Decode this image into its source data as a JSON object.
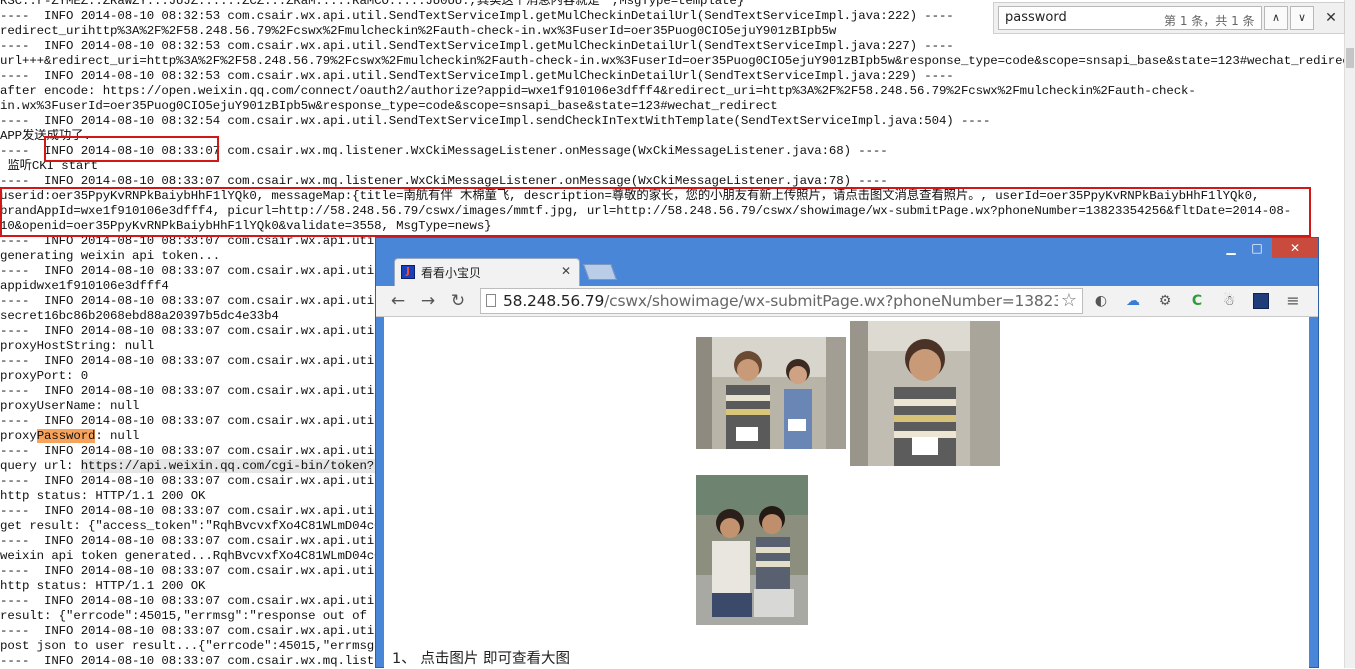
{
  "log": {
    "lines": [
      {
        "text": "RSC..r-ZYMEZ..ZRaWZY...JUJZ......ZCZ...ZRaM.....RaMCO.....JU0UU.,其实这个消息内容就是一,MsgType=template}",
        "parts": null
      },
      {
        "text": "----  INFO 2014-08-10 08:32:53 com.csair.wx.api.util.SendTextServiceImpl.getMulCheckinDetailUrl(SendTextServiceImpl.java:222) ----"
      },
      {
        "text": "redirect_urihttp%3A%2F%2F58.248.56.79%2Fcswx%2Fmulcheckin%2Fauth-check-in.wx%3FuserId=oer35Puog0CIO5ejuY901zBIpb5w"
      },
      {
        "text": "----  INFO 2014-08-10 08:32:53 com.csair.wx.api.util.SendTextServiceImpl.getMulCheckinDetailUrl(SendTextServiceImpl.java:227) ----"
      },
      {
        "text": "url+++&redirect_uri=http%3A%2F%2F58.248.56.79%2Fcswx%2Fmulcheckin%2Fauth-check-in.wx%3FuserId=oer35Puog0CIO5ejuY901zBIpb5w&response_type=code&scope=snsapi_base&state=123#wechat_redirect"
      },
      {
        "text": "----  INFO 2014-08-10 08:32:53 com.csair.wx.api.util.SendTextServiceImpl.getMulCheckinDetailUrl(SendTextServiceImpl.java:229) ----"
      },
      {
        "text": "after encode: https://open.weixin.qq.com/connect/oauth2/authorize?appid=wxe1f910106e3dfff4&redirect_uri=http%3A%2F%2F58.248.56.79%2Fcswx%2Fmulcheckin%2Fauth-check-"
      },
      {
        "text": "in.wx%3FuserId=oer35Puog0CIO5ejuY901zBIpb5w&response_type=code&scope=snsapi_base&state=123#wechat_redirect"
      },
      {
        "text": "----  INFO 2014-08-10 08:32:54 com.csair.wx.api.util.SendTextServiceImpl.sendCheckInTextWithTemplate(SendTextServiceImpl.java:504) ----"
      },
      {
        "text": "APP发送成功了."
      },
      {
        "text": "----  INFO 2014-08-10 08:33:07 com.csair.wx.mq.listener.WxCkiMessageListener.onMessage(WxCkiMessageListener.java:68) ----"
      },
      {
        "text": " 监听CKI start"
      },
      {
        "text": "----  INFO 2014-08-10 08:33:07 com.csair.wx.mq.listener.WxCkiMessageListener.onMessage(WxCkiMessageListener.java:78) ----"
      },
      {
        "text": "userid:oer35PpyKvRNPkBaiybHhF1lYQk0, messageMap:{title=南航有伴 木棉童飞, description=尊敬的家长，您的小朋友有新上传照片，请点击图文消息查看照片。, userId=oer35PpyKvRNPkBaiybHhF1lYQk0,"
      },
      {
        "text": "brandAppId=wxe1f910106e3dfff4, picurl=http://58.248.56.79/cswx/images/mmtf.jpg, url=http://58.248.56.79/cswx/showimage/wx-submitPage.wx?phoneNumber=13823354256&fltDate=2014-08-"
      },
      {
        "text": "10&openid=oer35PpyKvRNPkBaiybHhF1lYQk0&validate=3558, MsgType=news}"
      },
      {
        "text": "----  INFO 2014-08-10 08:33:07 com.csair.wx.api.util."
      },
      {
        "text": "generating weixin api token..."
      },
      {
        "text": "----  INFO 2014-08-10 08:33:07 com.csair.wx.api.util."
      },
      {
        "text": "appidwxe1f910106e3dfff4"
      },
      {
        "text": "----  INFO 2014-08-10 08:33:07 com.csair.wx.api.util."
      },
      {
        "text": "secret16bc86b2068ebd88a20397b5dc4e33b4"
      },
      {
        "text": "----  INFO 2014-08-10 08:33:07 com.csair.wx.api.util."
      },
      {
        "text": "proxyHostString: null"
      },
      {
        "text": "----  INFO 2014-08-10 08:33:07 com.csair.wx.api.util."
      },
      {
        "text": "proxyPort: 0"
      },
      {
        "text": "----  INFO 2014-08-10 08:33:07 com.csair.wx.api.util."
      },
      {
        "text": "proxyUserName: null"
      },
      {
        "text": "----  INFO 2014-08-10 08:33:07 com.csair.wx.api.util."
      },
      {
        "text": "proxyPassword: null"
      },
      {
        "text": "----  INFO 2014-08-10 08:33:07 com.csair.wx.api.util."
      },
      {
        "text": "query url: https://api.weixin.qq.com/cgi-bin/token?gr"
      },
      {
        "text": "----  INFO 2014-08-10 08:33:07 com.csair.wx.api.util."
      },
      {
        "text": "http status: HTTP/1.1 200 OK"
      },
      {
        "text": "----  INFO 2014-08-10 08:33:07 com.csair.wx.api.util."
      },
      {
        "text": "get result: {\"access_token\":\"RqhBvcvxfXo4C81WLmD04cGd"
      },
      {
        "text": "----  INFO 2014-08-10 08:33:07 com.csair.wx.api.util."
      },
      {
        "text": "weixin api token generated...RqhBvcvxfXo4C81WLmD04cGd"
      },
      {
        "text": "----  INFO 2014-08-10 08:33:07 com.csair.wx.api.util."
      },
      {
        "text": "http status: HTTP/1.1 200 OK"
      },
      {
        "text": "----  INFO 2014-08-10 08:33:07 com.csair.wx.api.util."
      },
      {
        "text": "result: {\"errcode\":45015,\"errmsg\":\"response out of ti"
      },
      {
        "text": "----  INFO 2014-08-10 08:33:07 com.csair.wx.api.util."
      },
      {
        "text": "post json to user result...{\"errcode\":45015,\"errmsg\":"
      },
      {
        "text": "----  INFO 2014-08-10 08:33:07 com.csair.wx.mq.listen"
      }
    ],
    "highlight": {
      "line": 29,
      "before": "proxy",
      "match": "Password",
      "after": ": null"
    },
    "url_highlight": {
      "line": 31,
      "before": "query url: ",
      "match": "https://api.weixin.qq.com/cgi-bin/token?gr"
    }
  },
  "findbar": {
    "query": "password",
    "count": "第 1 条，共 1 条",
    "prev": "∧",
    "next": "∨",
    "close": "✕"
  },
  "browser": {
    "tab_title": "看看小宝贝",
    "tab_close": "✕",
    "favicon_letter": "J",
    "win_min": "▁",
    "win_max": "□",
    "win_close": "✕",
    "nav": {
      "back": "←",
      "forward": "→",
      "reload": "↻"
    },
    "url_host": "58.248.56.79",
    "url_path": "/cswx/showimage/wx-submitPage.wx?phoneNumber=13823",
    "star": "☆",
    "ext": {
      "globe": "◐",
      "cloud": "☁",
      "gear": "⚙",
      "c": "C",
      "alien": "☃",
      "menu": "≡"
    },
    "caption": "1、 点击图片 即可查看大图"
  },
  "colors": {
    "annotation": "#d01818",
    "find_highlight": "#f7a35c",
    "window_frame": "#4a86d8",
    "window_close": "#c94b3e"
  }
}
